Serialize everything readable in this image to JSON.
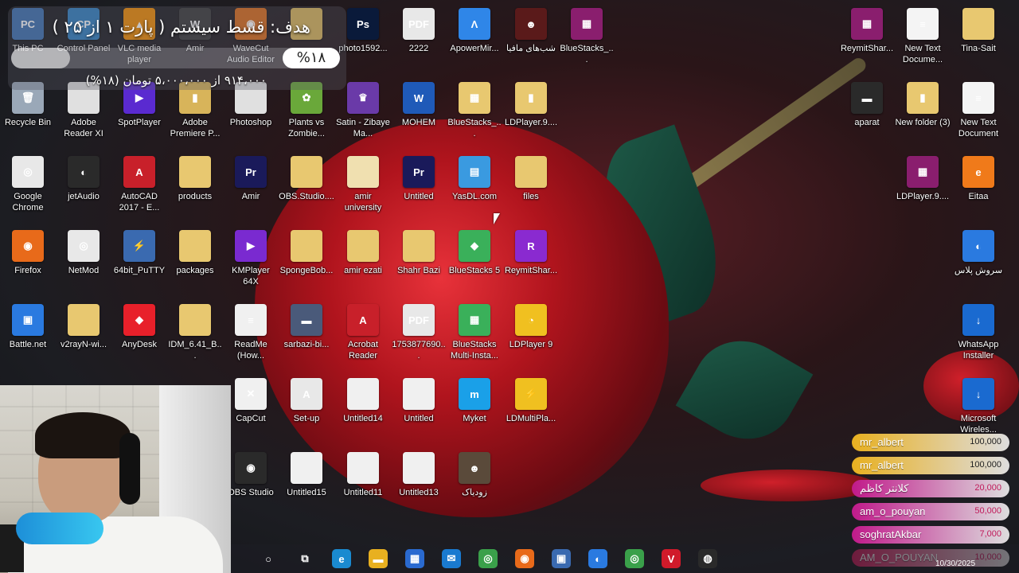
{
  "stream_goal": {
    "title": "هدف: قسط سیستم ( پارت ۱ از ۲۵ )",
    "percent_label": "%۱۸",
    "progress_fraction": 0.18,
    "amount_text": "۹۱۴،۰۰۰ از ۵،۰۰۰،۰۰۰ تومان (۱۸%)"
  },
  "desktop_icons": [
    {
      "label": "This PC",
      "color": "#3b6fb0",
      "glyph": "PC"
    },
    {
      "label": "Control Panel",
      "color": "#2f7fc0",
      "glyph": "CP"
    },
    {
      "label": "VLC media player",
      "color": "#f08a00",
      "glyph": "▲"
    },
    {
      "label": "Amir",
      "color": "#3a3a3a",
      "glyph": "W"
    },
    {
      "label": "WaveCut Audio Editor",
      "color": "#d96a1a",
      "glyph": "◉"
    },
    {
      "label": "",
      "color": "#d8b45a",
      "glyph": ""
    },
    {
      "label": "photo1592...",
      "color": "#0a1a3a",
      "glyph": "Ps"
    },
    {
      "label": "2222",
      "color": "#e8e8e8",
      "glyph": "PDF"
    },
    {
      "label": "ApowerMir...",
      "color": "#2f86e8",
      "glyph": "Λ"
    },
    {
      "label": "شب‌های مافیا",
      "color": "#5a1a1a",
      "glyph": "☻"
    },
    {
      "label": "BlueStacks_...",
      "color": "#8a1e6e",
      "glyph": "▦"
    },
    {
      "label": "Recycle Bin",
      "color": "#9aa8b8",
      "glyph": "🗑"
    },
    {
      "label": "Adobe Reader XI",
      "color": "#e0e0e0",
      "glyph": ""
    },
    {
      "label": "SpotPlayer",
      "color": "#5a2ad0",
      "glyph": "▶"
    },
    {
      "label": "Adobe Premiere P...",
      "color": "#d8b45a",
      "glyph": "▮"
    },
    {
      "label": "Photoshop",
      "color": "#e0e0e0",
      "glyph": ""
    },
    {
      "label": "Plants vs Zombie...",
      "color": "#6aa83a",
      "glyph": "✿"
    },
    {
      "label": "Satin - Zibaye Ma...",
      "color": "#6a3aa8",
      "glyph": "♛"
    },
    {
      "label": "MOHEM",
      "color": "#1f5ab8",
      "glyph": "W"
    },
    {
      "label": "BlueStacks_...",
      "color": "#e8c870",
      "glyph": "▦"
    },
    {
      "label": "LDPlayer.9....",
      "color": "#e8c870",
      "glyph": "▮"
    },
    {
      "label": "Google Chrome",
      "color": "#e8e8e8",
      "glyph": "◎"
    },
    {
      "label": "jetAudio",
      "color": "#2a2a2a",
      "glyph": "◐"
    },
    {
      "label": "AutoCAD 2017 - E...",
      "color": "#c8202a",
      "glyph": "A"
    },
    {
      "label": "products",
      "color": "#e8c870",
      "glyph": ""
    },
    {
      "label": "Amir",
      "color": "#1a1a5a",
      "glyph": "Pr"
    },
    {
      "label": "OBS.Studio....",
      "color": "#e8c870",
      "glyph": ""
    },
    {
      "label": "amir university",
      "color": "#f0e0b0",
      "glyph": ""
    },
    {
      "label": "Untitled",
      "color": "#1a1a5a",
      "glyph": "Pr"
    },
    {
      "label": "YasDL.com",
      "color": "#3a9ae0",
      "glyph": "▤"
    },
    {
      "label": "files",
      "color": "#e8c870",
      "glyph": ""
    },
    {
      "label": "Firefox",
      "color": "#e86a1a",
      "glyph": "◉"
    },
    {
      "label": "NetMod",
      "color": "#e8e8e8",
      "glyph": "◎"
    },
    {
      "label": "64bit_PuTTY",
      "color": "#3a6ab0",
      "glyph": "⚡"
    },
    {
      "label": "packages",
      "color": "#e8c870",
      "glyph": ""
    },
    {
      "label": "KMPlayer 64X",
      "color": "#7a2ad0",
      "glyph": "▶"
    },
    {
      "label": "SpongeBob...",
      "color": "#e8c870",
      "glyph": ""
    },
    {
      "label": "amir ezati",
      "color": "#e8c870",
      "glyph": ""
    },
    {
      "label": "Shahr Bazi",
      "color": "#e8c870",
      "glyph": ""
    },
    {
      "label": "BlueStacks 5",
      "color": "#3ab05a",
      "glyph": "◆"
    },
    {
      "label": "ReymitShar...",
      "color": "#8a2ad0",
      "glyph": "R"
    },
    {
      "label": "Battle.net",
      "color": "#2a7ae0",
      "glyph": "▣"
    },
    {
      "label": "v2rayN-wi...",
      "color": "#e8c870",
      "glyph": ""
    },
    {
      "label": "AnyDesk",
      "color": "#e8202a",
      "glyph": "◆"
    },
    {
      "label": "IDM_6.41_B...",
      "color": "#e8c870",
      "glyph": ""
    },
    {
      "label": "ReadMe (How...",
      "color": "#f0f0f0",
      "glyph": "≡"
    },
    {
      "label": "sarbazi-bi...",
      "color": "#4a5a7a",
      "glyph": "▬"
    },
    {
      "label": "Acrobat Reader",
      "color": "#c8202a",
      "glyph": "A"
    },
    {
      "label": "1753877690...",
      "color": "#e8e8e8",
      "glyph": "PDF"
    },
    {
      "label": "BlueStacks Multi-Insta...",
      "color": "#3ab05a",
      "glyph": "▦"
    },
    {
      "label": "LDPlayer 9",
      "color": "#f0c020",
      "glyph": "◔"
    },
    {
      "label": "CapCut",
      "color": "#f0f0f0",
      "glyph": "✕"
    },
    {
      "label": "Set-up",
      "color": "#e8e8e8",
      "glyph": "A"
    },
    {
      "label": "Untitled14",
      "color": "#f0f0f0",
      "glyph": ""
    },
    {
      "label": "Untitled",
      "color": "#f0f0f0",
      "glyph": ""
    },
    {
      "label": "Myket",
      "color": "#1aa0e8",
      "glyph": "m"
    },
    {
      "label": "LDMultiPla...",
      "color": "#f0c020",
      "glyph": "⚡"
    },
    {
      "label": "OBS Studio",
      "color": "#2a2a2a",
      "glyph": "◉"
    },
    {
      "label": "Untitled15",
      "color": "#f0f0f0",
      "glyph": ""
    },
    {
      "label": "Untitled11",
      "color": "#f0f0f0",
      "glyph": ""
    },
    {
      "label": "Untitled13",
      "color": "#f0f0f0",
      "glyph": ""
    },
    {
      "label": "زودیاک",
      "color": "#5a4a3a",
      "glyph": "☻"
    },
    {
      "label": "ReymitShar...",
      "color": "#8a1e6e",
      "glyph": "▦"
    },
    {
      "label": "New Text Docume...",
      "color": "#f4f4f4",
      "glyph": "≡"
    },
    {
      "label": "Tina-Sait",
      "color": "#e8c870",
      "glyph": ""
    },
    {
      "label": "aparat",
      "color": "#2a2a2a",
      "glyph": "▬"
    },
    {
      "label": "New folder (3)",
      "color": "#e8c870",
      "glyph": "▮"
    },
    {
      "label": "New Text Document",
      "color": "#f4f4f4",
      "glyph": "≡"
    },
    {
      "label": "LDPlayer.9....",
      "color": "#8a1e6e",
      "glyph": "▦"
    },
    {
      "label": "Eitaa",
      "color": "#f07a1a",
      "glyph": "e"
    },
    {
      "label": "سروش پلاس",
      "color": "#2a7ae0",
      "glyph": "◐"
    },
    {
      "label": "WhatsApp Installer",
      "color": "#1a6ad0",
      "glyph": "↓"
    },
    {
      "label": "Microsoft Wireles...",
      "color": "#1a6ad0",
      "glyph": "↓"
    }
  ],
  "donations": [
    {
      "name": "mr_albert",
      "amount": "100,000",
      "color": "#e8b020"
    },
    {
      "name": "mr_albert",
      "amount": "100,000",
      "color": "#e8b020"
    },
    {
      "name": "کلانتر کاظم",
      "amount": "20,000",
      "color": "#c01a8a"
    },
    {
      "name": "am_o_pouyan",
      "amount": "50,000",
      "color": "#c01a8a"
    },
    {
      "name": "soghratAkbar",
      "amount": "7,000",
      "color": "#c01a8a"
    },
    {
      "name": "AM_O_POUYAN",
      "amount": "10,000",
      "color": "#d01a5a"
    }
  ],
  "taskbar": {
    "items": [
      {
        "name": "search-button",
        "glyph": "○",
        "color": "transparent"
      },
      {
        "name": "task-view-button",
        "glyph": "⧉",
        "color": "transparent"
      },
      {
        "name": "edge-icon",
        "glyph": "e",
        "color": "#1a8ad0"
      },
      {
        "name": "file-explorer-icon",
        "glyph": "▬",
        "color": "#e8b020"
      },
      {
        "name": "microsoft-store-icon",
        "glyph": "▦",
        "color": "#2a6ad0"
      },
      {
        "name": "mail-icon",
        "glyph": "✉",
        "color": "#1a7ad0"
      },
      {
        "name": "chrome-icon",
        "glyph": "◎",
        "color": "#3aa04a"
      },
      {
        "name": "firefox-icon",
        "glyph": "◉",
        "color": "#e86a1a"
      },
      {
        "name": "vpn-icon",
        "glyph": "▣",
        "color": "#3a6ab0"
      },
      {
        "name": "soroush-icon",
        "glyph": "◐",
        "color": "#2a7ae0"
      },
      {
        "name": "chrome-profile-icon",
        "glyph": "◎",
        "color": "#3aa04a"
      },
      {
        "name": "vivaldi-icon",
        "glyph": "V",
        "color": "#d01a2a"
      },
      {
        "name": "app-icon",
        "glyph": "◍",
        "color": "#2a2a2a"
      }
    ],
    "date": "10/30/2025"
  }
}
